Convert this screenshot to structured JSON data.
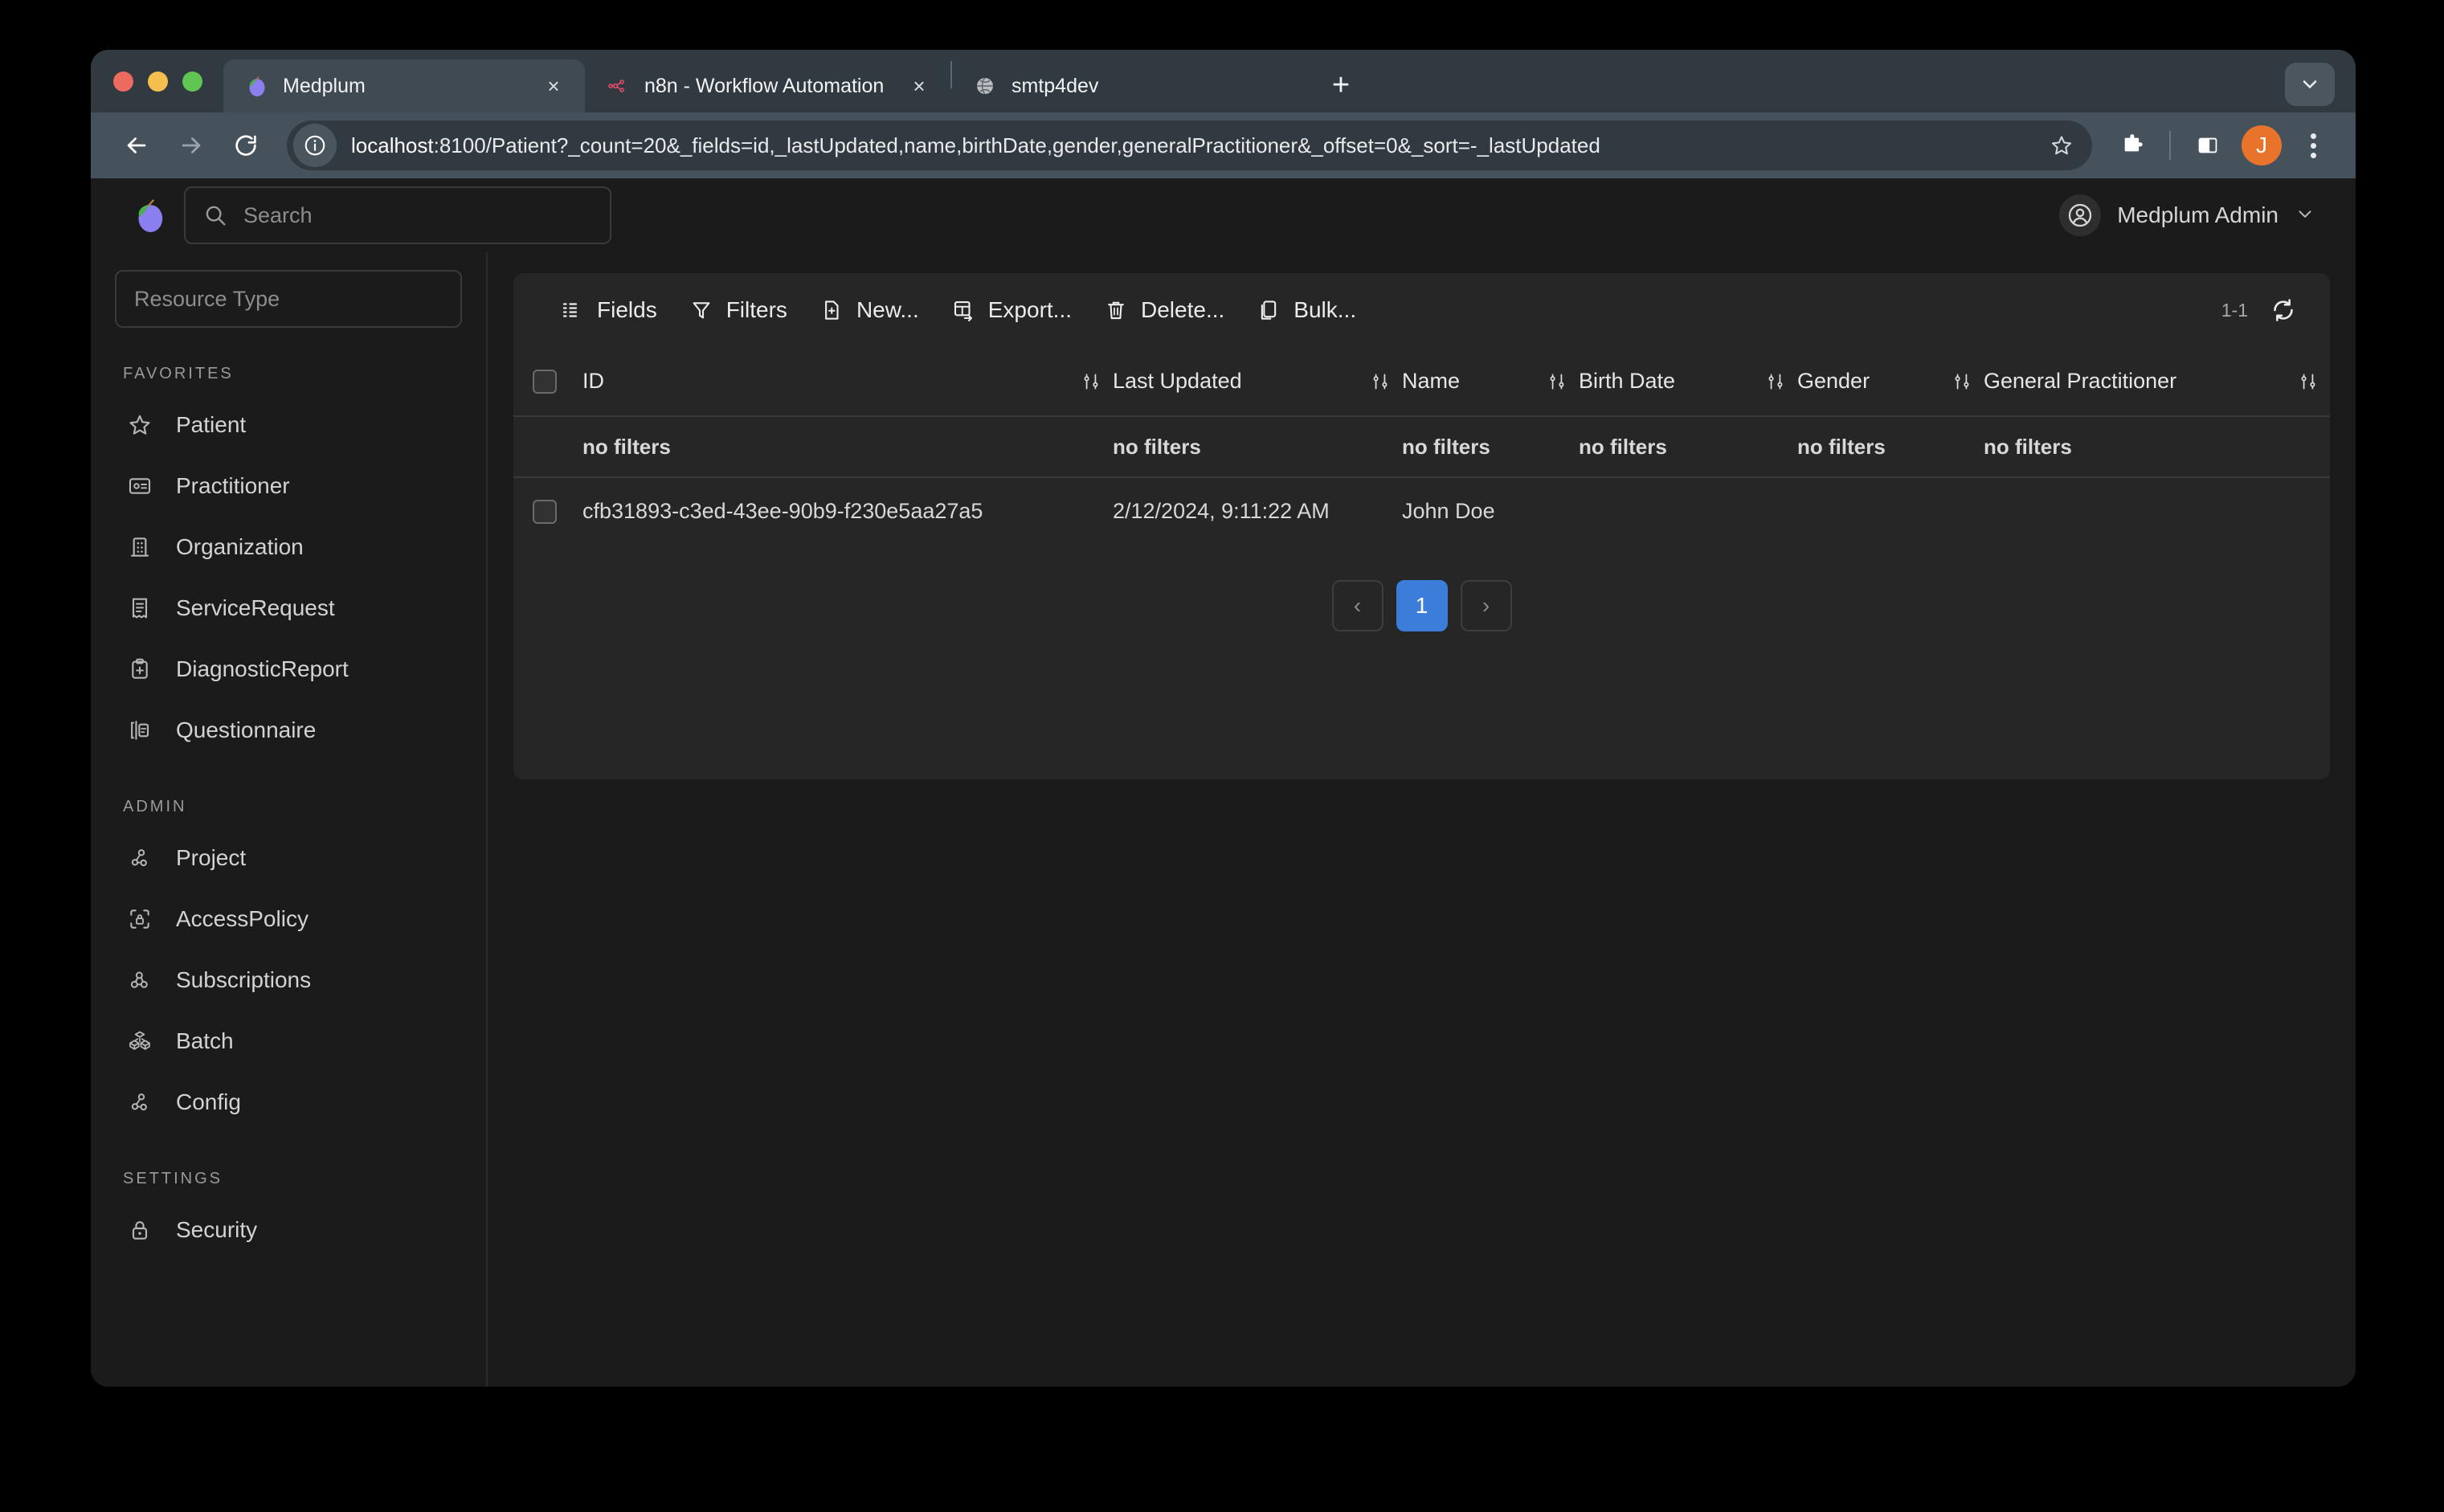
{
  "browser": {
    "tabs": [
      {
        "title": "Medplum",
        "icon": "medplum-plum-icon",
        "active": true,
        "close_label": "×"
      },
      {
        "title": "n8n - Workflow Automation",
        "icon": "n8n-icon",
        "active": false,
        "close_label": "×"
      },
      {
        "title": "smtp4dev",
        "icon": "globe-icon",
        "active": false,
        "close_label": ""
      }
    ],
    "new_tab_label": "+",
    "url": "localhost:8100/Patient?_count=20&_fields=id,_lastUpdated,name,birthDate,gender,generalPractitioner&_offset=0&_sort=-_lastUpdated",
    "url_host": "localhost",
    "url_path": ":8100/Patient?_count=20&_fields=id,_lastUpdated,name,birthDate,gender,generalPractitioner&_offset=0&_sort=-_lastUpdated",
    "profile_initial": "J",
    "profile_color": "#e8732a"
  },
  "app": {
    "logo": "medplum-plum-logo",
    "search": {
      "placeholder": "Search",
      "value": ""
    },
    "user": {
      "name": "Medplum Admin"
    }
  },
  "sidebar": {
    "resource_type_filter": {
      "placeholder": "Resource Type",
      "value": ""
    },
    "sections": [
      {
        "label": "FAVORITES",
        "items": [
          {
            "label": "Patient",
            "icon": "star-icon"
          },
          {
            "label": "Practitioner",
            "icon": "id-badge-icon"
          },
          {
            "label": "Organization",
            "icon": "building-icon"
          },
          {
            "label": "ServiceRequest",
            "icon": "receipt-icon"
          },
          {
            "label": "DiagnosticReport",
            "icon": "clipboard-plus-icon"
          },
          {
            "label": "Questionnaire",
            "icon": "forms-icon"
          }
        ]
      },
      {
        "label": "ADMIN",
        "items": [
          {
            "label": "Project",
            "icon": "nodes-icon"
          },
          {
            "label": "AccessPolicy",
            "icon": "scan-lock-icon"
          },
          {
            "label": "Subscriptions",
            "icon": "webhook-icon"
          },
          {
            "label": "Batch",
            "icon": "cubes-icon"
          },
          {
            "label": "Config",
            "icon": "nodes-icon"
          }
        ]
      },
      {
        "label": "SETTINGS",
        "items": [
          {
            "label": "Security",
            "icon": "lock-icon"
          }
        ]
      }
    ]
  },
  "toolbar": {
    "actions": [
      {
        "label": "Fields",
        "icon": "columns-icon"
      },
      {
        "label": "Filters",
        "icon": "funnel-icon"
      },
      {
        "label": "New...",
        "icon": "file-plus-icon"
      },
      {
        "label": "Export...",
        "icon": "table-export-icon"
      },
      {
        "label": "Delete...",
        "icon": "trash-icon"
      },
      {
        "label": "Bulk...",
        "icon": "copy-icon"
      }
    ],
    "result_count": "1-1",
    "refresh_icon": "refresh-icon"
  },
  "table": {
    "columns": [
      {
        "label": "ID",
        "sort_icon": "adjustments-icon"
      },
      {
        "label": "Last Updated",
        "sort_icon": "adjustments-icon"
      },
      {
        "label": "Name",
        "sort_icon": "adjustments-icon"
      },
      {
        "label": "Birth Date",
        "sort_icon": "adjustments-icon"
      },
      {
        "label": "Gender",
        "sort_icon": "adjustments-icon"
      },
      {
        "label": "General Practitioner",
        "sort_icon": "adjustments-icon"
      }
    ],
    "filter_row": {
      "id": "no filters",
      "last_updated": "no filters",
      "name": "no filters",
      "birth_date": "no filters",
      "gender": "no filters",
      "general_practitioner": "no filters"
    },
    "rows": [
      {
        "id": "cfb31893-c3ed-43ee-90b9-f230e5aa27a5",
        "last_updated": "2/12/2024, 9:11:22 AM",
        "name": "John Doe",
        "birth_date": "",
        "gender": "",
        "general_practitioner": ""
      }
    ]
  },
  "pagination": {
    "prev_label": "‹",
    "next_label": "›",
    "pages": [
      {
        "label": "1",
        "active": true
      }
    ],
    "active_color": "#3b7dd8"
  }
}
